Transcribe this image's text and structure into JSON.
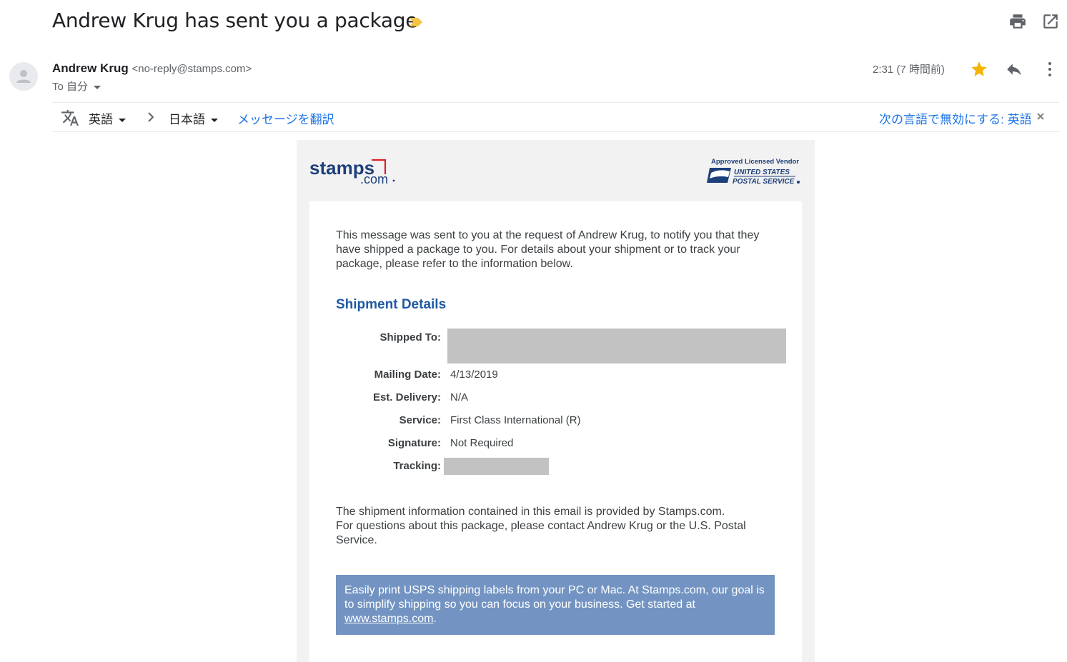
{
  "email": {
    "subject": "Andrew Krug has sent you a package",
    "sender_name": "Andrew Krug",
    "sender_email": "<no-reply@stamps.com>",
    "to_label": "To 自分",
    "time": "2:31 (7 時間前)"
  },
  "translate": {
    "source_lang": "英語",
    "target_lang": "日本語",
    "translate_link": "メッセージを翻訳",
    "disable_text": "次の言語で無効にする: 英語"
  },
  "brand": {
    "stamps_word": "stamps",
    "dotcom": ".com",
    "usps_approved": "Approved Licensed Vendor",
    "usps_line1": "UNITED STATES",
    "usps_line2": "POSTAL SERVICE",
    "stamps_blue": "#1d3f7a",
    "stamps_red": "#d8232a"
  },
  "message": {
    "intro": "This message was sent to you at the request of Andrew Krug, to notify you that they have shipped a package to you. For details about your shipment or to track your package, please refer to the information below.",
    "shipment_title": "Shipment Details",
    "details": {
      "shipped_to_label": "Shipped To:",
      "mailing_date_label": "Mailing Date:",
      "mailing_date": "4/13/2019",
      "est_delivery_label": "Est. Delivery:",
      "est_delivery": "N/A",
      "service_label": "Service:",
      "service": "First Class International (R)",
      "signature_label": "Signature:",
      "signature": "Not Required",
      "tracking_label": "Tracking:"
    },
    "footer_line1": "The shipment information contained in this email is provided by Stamps.com.",
    "footer_line2": "For questions about this package, please contact Andrew Krug or the U.S. Postal Service.",
    "promo_text": "Easily print USPS shipping labels from your PC or Mac. At Stamps.com, our goal is to simplify shipping so you can focus on your business. Get started at ",
    "promo_link": "www.stamps.com",
    "promo_end": "."
  },
  "icons": {
    "print": "print-icon",
    "open_new_window": "open-in-new-icon",
    "star": "star-icon",
    "reply": "reply-icon",
    "more": "more-vert-icon",
    "translate": "translate-icon",
    "importance": "importance-marker-icon"
  },
  "colors": {
    "star": "#f4b400",
    "importance": "#f6c344",
    "link_blue": "#1a73e8",
    "shipment_title": "#1f5aa3",
    "promo_bg": "#7394c2"
  }
}
